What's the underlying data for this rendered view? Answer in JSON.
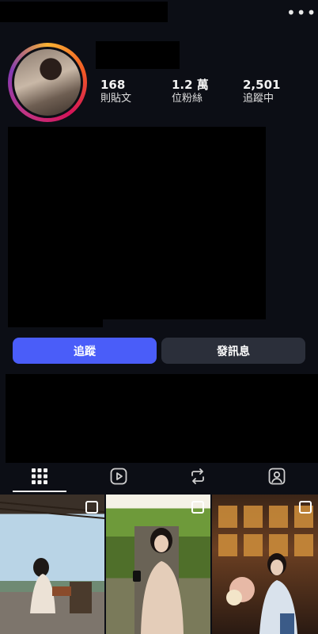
{
  "stats": [
    {
      "value": "168",
      "label": "則貼文"
    },
    {
      "value": "1.2 萬",
      "label": "位粉絲"
    },
    {
      "value": "2,501",
      "label": "追蹤中"
    }
  ],
  "buttons": {
    "follow": "追蹤",
    "message": "發訊息"
  },
  "tabs": [
    {
      "name": "posts",
      "icon": "grid-icon",
      "selected": true
    },
    {
      "name": "reels",
      "icon": "play-icon",
      "selected": false
    },
    {
      "name": "reposts",
      "icon": "repost-icon",
      "selected": false
    },
    {
      "name": "tagged",
      "icon": "tagged-person-icon",
      "selected": false
    }
  ],
  "colors": {
    "background": "#0c0e15",
    "follow_button": "#4a5df9",
    "message_button": "#2b2f3a"
  }
}
